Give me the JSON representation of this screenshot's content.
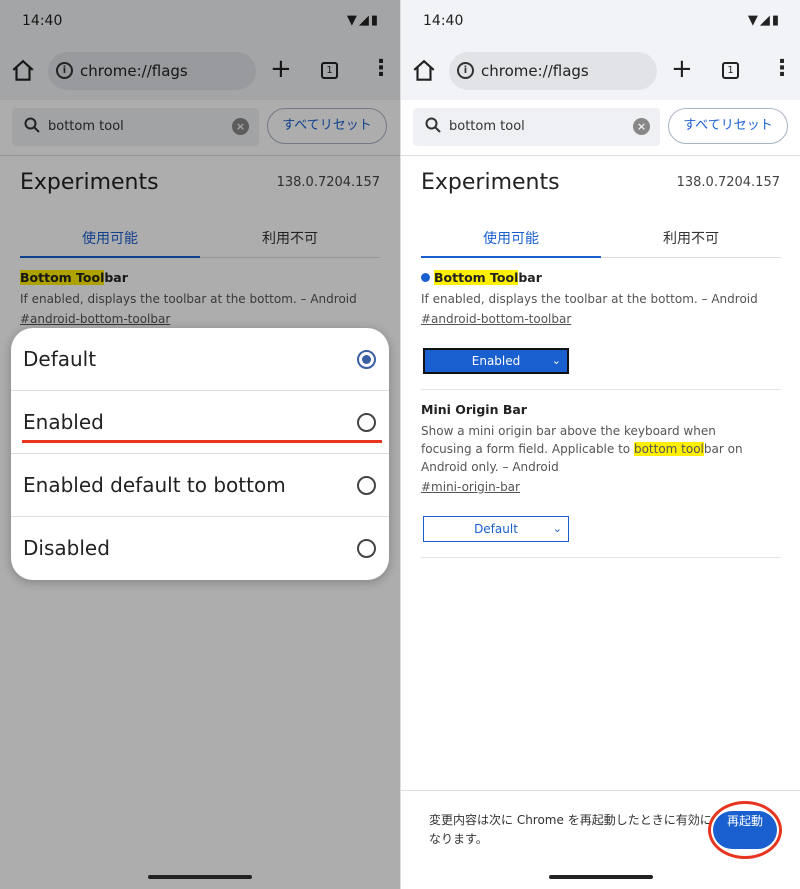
{
  "status": {
    "time": "14:40"
  },
  "toolbar": {
    "url": "chrome://flags",
    "tab_count": "1"
  },
  "search": {
    "value": "bottom tool",
    "reset_label": "すべてリセット"
  },
  "page": {
    "title": "Experiments",
    "version": "138.0.7204.157",
    "tabs": [
      "使用可能",
      "利用不可"
    ]
  },
  "flags": [
    {
      "title_hl": "Bottom Tool",
      "title_rest": "bar",
      "desc": "If enabled, displays the toolbar at the bottom. – Android",
      "link": "#android-bottom-toolbar",
      "value": "Enabled"
    },
    {
      "title": "Mini Origin Bar",
      "desc_pre": "Show a mini origin bar above the keyboard when focusing a form field. Applicable to ",
      "desc_hl": "bottom tool",
      "desc_post": "bar on Android only. – Android",
      "link": "#mini-origin-bar",
      "value": "Default"
    }
  ],
  "dialog": {
    "options": [
      "Default",
      "Enabled",
      "Enabled default to bottom",
      "Disabled"
    ],
    "selected": "Default"
  },
  "restart": {
    "message": "変更内容は次に Chrome を再起動したときに有効になります。",
    "button_label": "再起動"
  },
  "colors": {
    "accent": "#1a5fd0",
    "highlight": "#ffef00",
    "annotation": "#e8351f"
  }
}
